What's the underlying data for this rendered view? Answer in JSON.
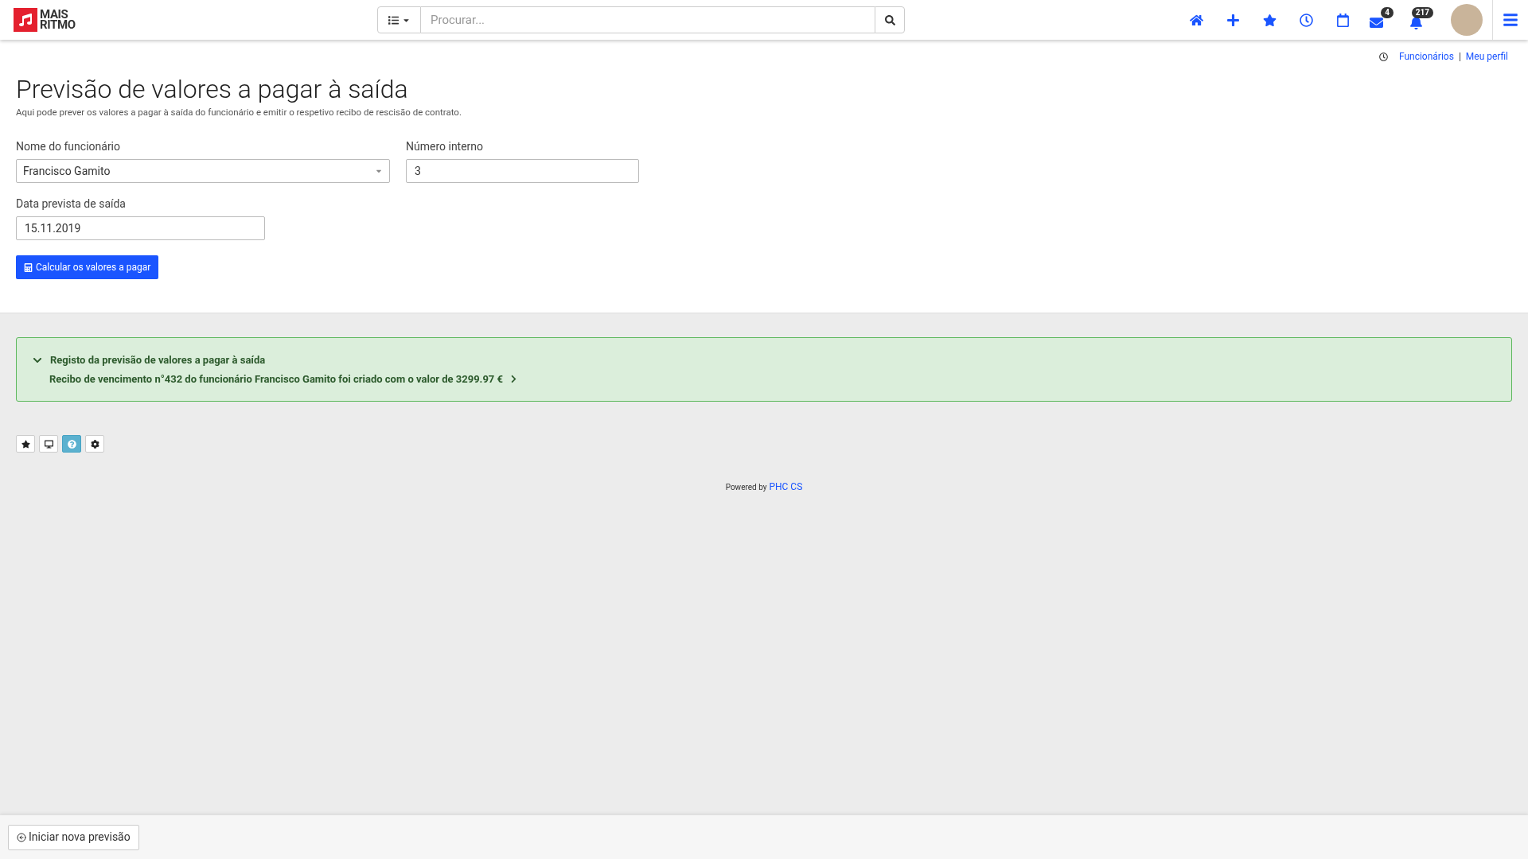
{
  "header": {
    "logo": {
      "line1": "MAIS",
      "line2": "RITMO"
    },
    "search": {
      "placeholder": "Procurar..."
    },
    "nav_icons": [
      {
        "kind": "home"
      },
      {
        "kind": "add"
      },
      {
        "kind": "favorites"
      },
      {
        "kind": "clock"
      },
      {
        "kind": "calendar"
      },
      {
        "kind": "mail",
        "badge": "4"
      },
      {
        "kind": "bell",
        "badge": "217"
      }
    ]
  },
  "breadcrumb": {
    "links": [
      "Funcionários",
      "Meu perfil"
    ],
    "separator": "|"
  },
  "page": {
    "title": "Previsão de valores a pagar à saída",
    "subtitle": "Aqui pode prever os valores a pagar à saída do funcionário e emitir o respetivo recibo de rescisão de contrato."
  },
  "form": {
    "employee_name": {
      "label": "Nome do funcionário",
      "value": "Francisco Gamito"
    },
    "internal_number": {
      "label": "Número interno",
      "value": "3"
    },
    "exit_date": {
      "label": "Data prevista de saída",
      "value": "15.11.2019"
    },
    "submit": "Calcular os valores a pagar"
  },
  "alert": {
    "expanded": true,
    "title": "Registo da previsão de valores a pagar à saída",
    "message": "Recibo de vencimento n°432 do funcionário Francisco Gamito foi criado com o valor de 3299.97 €"
  },
  "toolbar": [
    {
      "kind": "star",
      "selected": false
    },
    {
      "kind": "screen",
      "selected": false
    },
    {
      "kind": "help",
      "selected": true
    },
    {
      "kind": "settings",
      "selected": false
    }
  ],
  "powered_by": {
    "text": "Powered by",
    "link": "PHC CS"
  },
  "footer": {
    "button": "Iniciar nova previsão"
  }
}
